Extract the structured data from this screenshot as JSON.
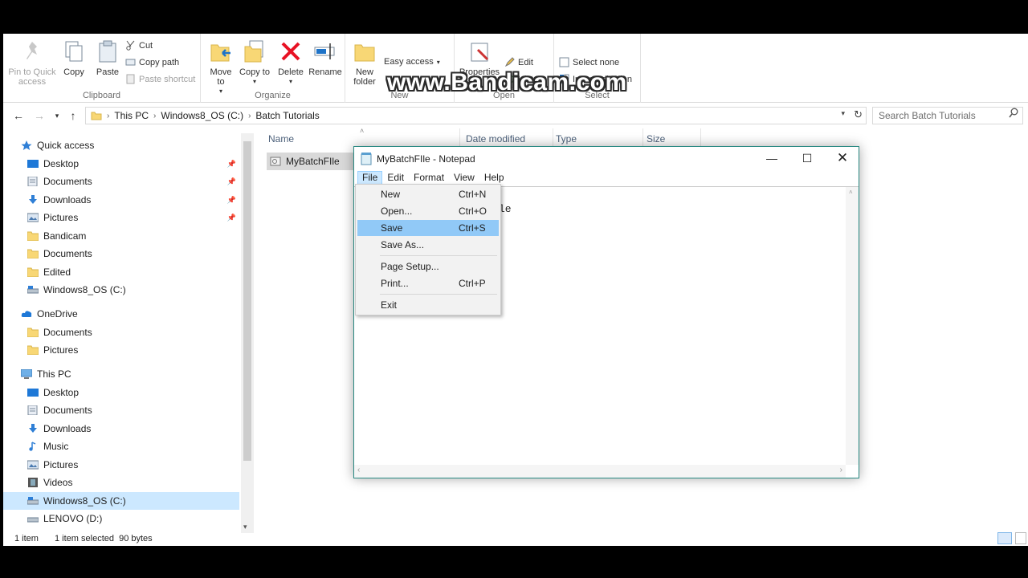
{
  "ribbon": {
    "clipboard": {
      "pin_label": "Pin to Quick access",
      "copy_label": "Copy",
      "paste_label": "Paste",
      "cut_label": "Cut",
      "copy_path_label": "Copy path",
      "paste_shortcut_label": "Paste shortcut",
      "group_label": "Clipboard"
    },
    "organize": {
      "move_to_label": "Move to",
      "copy_to_label": "Copy to",
      "delete_label": "Delete",
      "rename_label": "Rename",
      "group_label": "Organize"
    },
    "new": {
      "new_folder_label": "New folder",
      "easy_access_label": "Easy access",
      "group_label": "New"
    },
    "open": {
      "properties_label": "Properties",
      "edit_label": "Edit",
      "history_label": "History",
      "group_label": "Open"
    },
    "select": {
      "select_none_label": "Select none",
      "invert_selection_label": "Invert selection",
      "group_label": "Select"
    }
  },
  "address": {
    "crumbs": [
      "This PC",
      "Windows8_OS (C:)",
      "Batch Tutorials"
    ],
    "search_placeholder": "Search Batch Tutorials"
  },
  "nav": {
    "quick_access": "Quick access",
    "qa_items": [
      "Desktop",
      "Documents",
      "Downloads",
      "Pictures",
      "Bandicam",
      "Documents",
      "Edited",
      "Windows8_OS (C:)"
    ],
    "onedrive": "OneDrive",
    "od_items": [
      "Documents",
      "Pictures"
    ],
    "this_pc": "This PC",
    "pc_items": [
      "Desktop",
      "Documents",
      "Downloads",
      "Music",
      "Pictures",
      "Videos",
      "Windows8_OS (C:)",
      "LENOVO (D:)"
    ]
  },
  "columns": {
    "name": "Name",
    "date_modified": "Date modified",
    "type": "Type",
    "size": "Size"
  },
  "files": [
    {
      "name": "MyBatchFIle"
    }
  ],
  "status": {
    "count": "1 item",
    "selection": "1 item selected  90 bytes"
  },
  "notepad": {
    "title": "MyBatchFIle - Notepad",
    "menus": [
      "File",
      "Edit",
      "Format",
      "View",
      "Help"
    ],
    "visible_text": "le",
    "file_menu": [
      {
        "label": "New",
        "shortcut": "Ctrl+N"
      },
      {
        "label": "Open...",
        "shortcut": "Ctrl+O"
      },
      {
        "label": "Save",
        "shortcut": "Ctrl+S"
      },
      {
        "label": "Save As...",
        "shortcut": ""
      },
      {
        "label": "Page Setup...",
        "shortcut": ""
      },
      {
        "label": "Print...",
        "shortcut": "Ctrl+P"
      },
      {
        "label": "Exit",
        "shortcut": ""
      }
    ]
  },
  "watermark": "www.Bandicam.com",
  "colors": {
    "accent": "#0078d7",
    "selection": "#cce8ff",
    "menu_highlight": "#91c9f7",
    "delete_red": "#e81123",
    "folder_yellow": "#f8d775"
  }
}
